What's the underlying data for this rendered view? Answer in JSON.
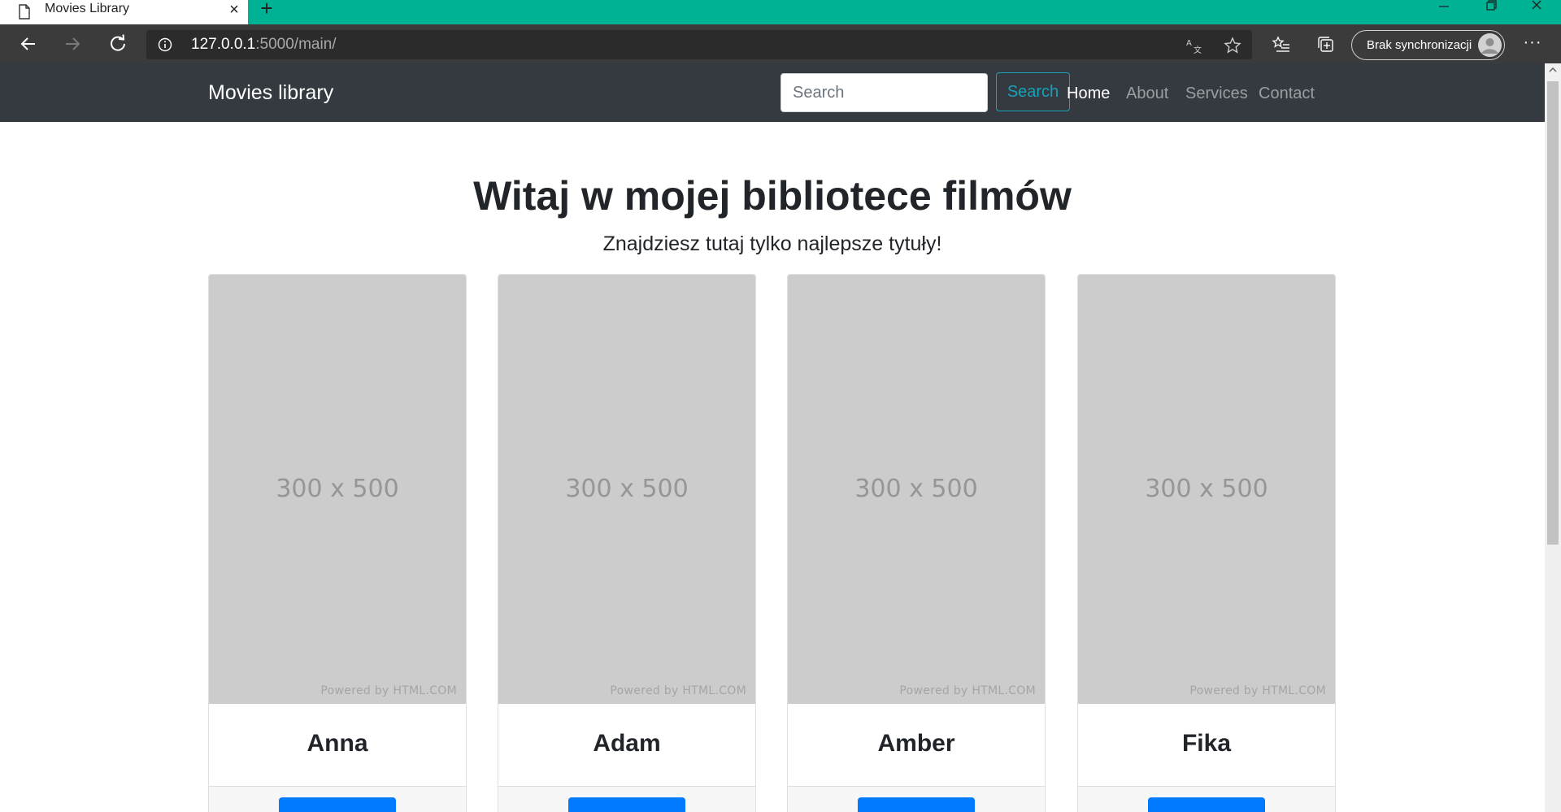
{
  "browser": {
    "tab_title": "Movies Library",
    "url_host": "127.0.0.1",
    "url_rest": ":5000/main/",
    "sync_label": "Brak synchronizacji",
    "more_label": "···",
    "accent_color": "#00b294"
  },
  "navbar": {
    "brand": "Movies library",
    "search_placeholder": "Search",
    "search_button": "Search",
    "links": [
      {
        "label": "Home",
        "active": true
      },
      {
        "label": "About",
        "active": false
      },
      {
        "label": "Services",
        "active": false
      },
      {
        "label": "Contact",
        "active": false
      }
    ]
  },
  "hero": {
    "title": "Witaj w mojej bibliotece filmów",
    "subtitle": "Znajdziesz tutaj tylko najlepsze tytuły!"
  },
  "cards": [
    {
      "title": "Anna",
      "image_text": "300 x 500",
      "image_credit": "Powered by HTML.COM",
      "button_label": ""
    },
    {
      "title": "Adam",
      "image_text": "300 x 500",
      "image_credit": "Powered by HTML.COM",
      "button_label": ""
    },
    {
      "title": "Amber",
      "image_text": "300 x 500",
      "image_credit": "Powered by HTML.COM",
      "button_label": ""
    },
    {
      "title": "Fika",
      "image_text": "300 x 500",
      "image_credit": "Powered by HTML.COM",
      "button_label": ""
    }
  ],
  "colors": {
    "navbar_bg": "#343a40",
    "search_button": "#17a2b8",
    "primary_button": "#007bff",
    "placeholder_bg": "#cccccc"
  }
}
